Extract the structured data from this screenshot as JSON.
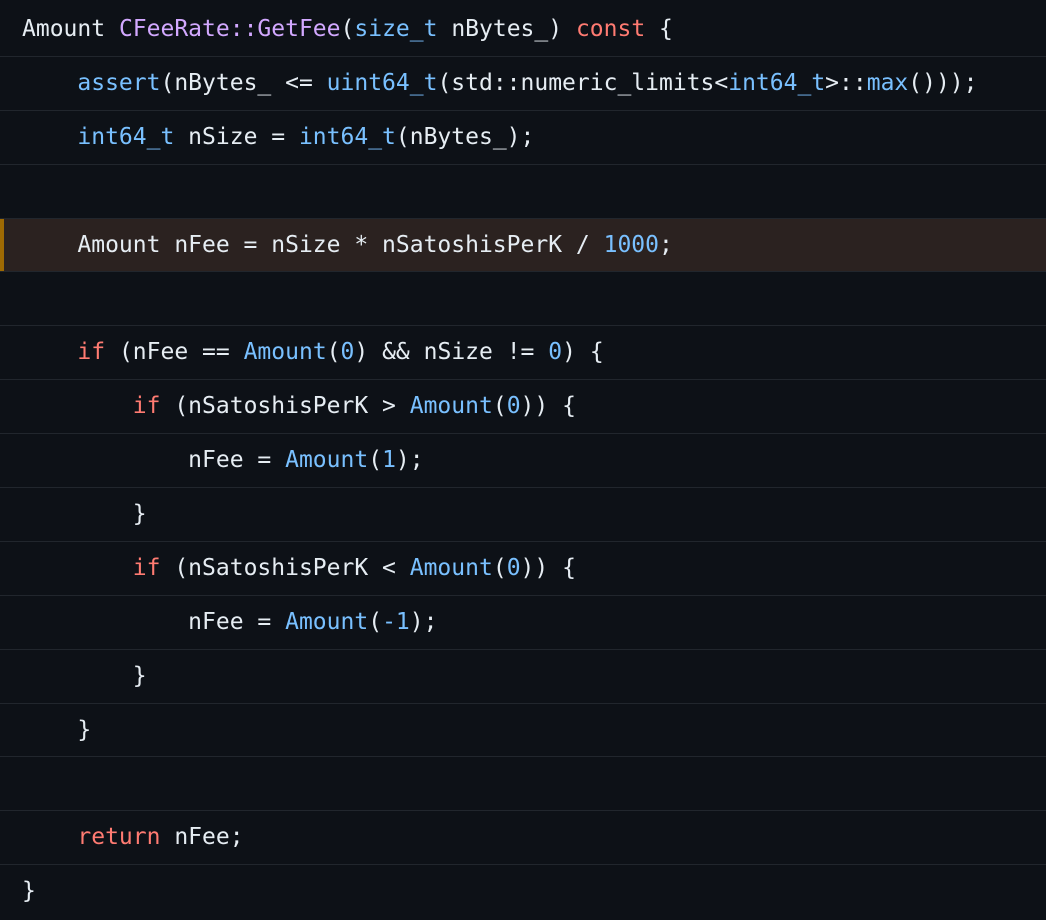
{
  "code": {
    "indent_unit": "    ",
    "colors": {
      "background": "#0d1117",
      "highlight_background": "#2b2220",
      "highlight_marker": "#9e6a03",
      "plain": "#e6edf3",
      "function": "#d2a8ff",
      "builtin": "#79c0ff",
      "keyword": "#ff7b72",
      "number": "#79c0ff"
    },
    "lines": [
      {
        "indent": 0,
        "highlighted": false,
        "tokens": [
          {
            "t": "Amount ",
            "k": "type"
          },
          {
            "t": "CFeeRate",
            "k": "func"
          },
          {
            "t": "::",
            "k": "func"
          },
          {
            "t": "GetFee",
            "k": "func"
          },
          {
            "t": "(",
            "k": "plain"
          },
          {
            "t": "size_t",
            "k": "builtin"
          },
          {
            "t": " nBytes_) ",
            "k": "plain"
          },
          {
            "t": "const",
            "k": "keyword"
          },
          {
            "t": " {",
            "k": "plain"
          }
        ]
      },
      {
        "indent": 1,
        "highlighted": false,
        "tokens": [
          {
            "t": "assert",
            "k": "builtin"
          },
          {
            "t": "(nBytes_ <= ",
            "k": "plain"
          },
          {
            "t": "uint64_t",
            "k": "builtin"
          },
          {
            "t": "(std::numeric_limits<",
            "k": "plain"
          },
          {
            "t": "int64_t",
            "k": "builtin"
          },
          {
            "t": ">::",
            "k": "plain"
          },
          {
            "t": "max",
            "k": "builtin"
          },
          {
            "t": "()));",
            "k": "plain"
          }
        ]
      },
      {
        "indent": 1,
        "highlighted": false,
        "tokens": [
          {
            "t": "int64_t",
            "k": "builtin"
          },
          {
            "t": " nSize = ",
            "k": "plain"
          },
          {
            "t": "int64_t",
            "k": "builtin"
          },
          {
            "t": "(nBytes_);",
            "k": "plain"
          }
        ]
      },
      {
        "indent": 0,
        "highlighted": false,
        "tokens": []
      },
      {
        "indent": 1,
        "highlighted": true,
        "tokens": [
          {
            "t": "Amount nFee = nSize * nSatoshisPerK / ",
            "k": "plain"
          },
          {
            "t": "1000",
            "k": "number"
          },
          {
            "t": ";",
            "k": "plain"
          }
        ]
      },
      {
        "indent": 0,
        "highlighted": false,
        "tokens": []
      },
      {
        "indent": 1,
        "highlighted": false,
        "tokens": [
          {
            "t": "if",
            "k": "keyword"
          },
          {
            "t": " (nFee == ",
            "k": "plain"
          },
          {
            "t": "Amount",
            "k": "builtin"
          },
          {
            "t": "(",
            "k": "plain"
          },
          {
            "t": "0",
            "k": "number"
          },
          {
            "t": ") && nSize != ",
            "k": "plain"
          },
          {
            "t": "0",
            "k": "number"
          },
          {
            "t": ") {",
            "k": "plain"
          }
        ]
      },
      {
        "indent": 2,
        "highlighted": false,
        "tokens": [
          {
            "t": "if",
            "k": "keyword"
          },
          {
            "t": " (nSatoshisPerK > ",
            "k": "plain"
          },
          {
            "t": "Amount",
            "k": "builtin"
          },
          {
            "t": "(",
            "k": "plain"
          },
          {
            "t": "0",
            "k": "number"
          },
          {
            "t": ")) {",
            "k": "plain"
          }
        ]
      },
      {
        "indent": 3,
        "highlighted": false,
        "tokens": [
          {
            "t": "nFee = ",
            "k": "plain"
          },
          {
            "t": "Amount",
            "k": "builtin"
          },
          {
            "t": "(",
            "k": "plain"
          },
          {
            "t": "1",
            "k": "number"
          },
          {
            "t": ");",
            "k": "plain"
          }
        ]
      },
      {
        "indent": 2,
        "highlighted": false,
        "tokens": [
          {
            "t": "}",
            "k": "plain"
          }
        ]
      },
      {
        "indent": 2,
        "highlighted": false,
        "tokens": [
          {
            "t": "if",
            "k": "keyword"
          },
          {
            "t": " (nSatoshisPerK < ",
            "k": "plain"
          },
          {
            "t": "Amount",
            "k": "builtin"
          },
          {
            "t": "(",
            "k": "plain"
          },
          {
            "t": "0",
            "k": "number"
          },
          {
            "t": ")) {",
            "k": "plain"
          }
        ]
      },
      {
        "indent": 3,
        "highlighted": false,
        "tokens": [
          {
            "t": "nFee = ",
            "k": "plain"
          },
          {
            "t": "Amount",
            "k": "builtin"
          },
          {
            "t": "(",
            "k": "plain"
          },
          {
            "t": "-1",
            "k": "number"
          },
          {
            "t": ");",
            "k": "plain"
          }
        ]
      },
      {
        "indent": 2,
        "highlighted": false,
        "tokens": [
          {
            "t": "}",
            "k": "plain"
          }
        ]
      },
      {
        "indent": 1,
        "highlighted": false,
        "tokens": [
          {
            "t": "}",
            "k": "plain"
          }
        ]
      },
      {
        "indent": 0,
        "highlighted": false,
        "tokens": []
      },
      {
        "indent": 1,
        "highlighted": false,
        "tokens": [
          {
            "t": "return",
            "k": "keyword"
          },
          {
            "t": " nFee;",
            "k": "plain"
          }
        ]
      },
      {
        "indent": 0,
        "highlighted": false,
        "tokens": [
          {
            "t": "}",
            "k": "plain"
          }
        ]
      }
    ]
  }
}
